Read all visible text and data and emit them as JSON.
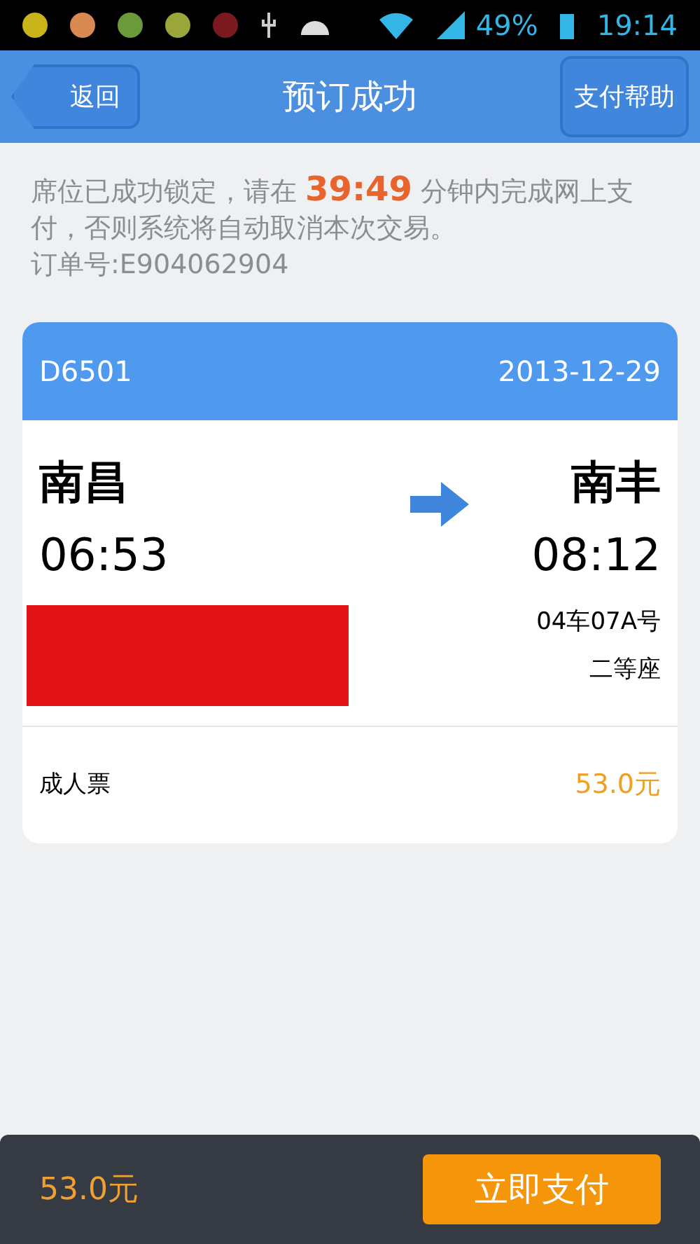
{
  "status_bar": {
    "battery": "49%",
    "time": "19:14"
  },
  "header": {
    "back": "返回",
    "title": "预订成功",
    "help": "支付帮助"
  },
  "notice": "席位已成功锁定，请在 **39:49** 分钟内完成网上支付，否则系统将自动取消本次交易。",
  "order_number": "订单号:E904062904",
  "ticket": {
    "train": "D6501",
    "date": "2013-12-29",
    "from": "南昌",
    "depart": "06:53",
    "to": "南丰",
    "arrive": "08:12",
    "seat": "04车07A号",
    "class": "二等座",
    "fare_type": "成人票",
    "fare": "53.0元"
  },
  "footer": {
    "total": "53.0元",
    "pay": "立即支付"
  }
}
